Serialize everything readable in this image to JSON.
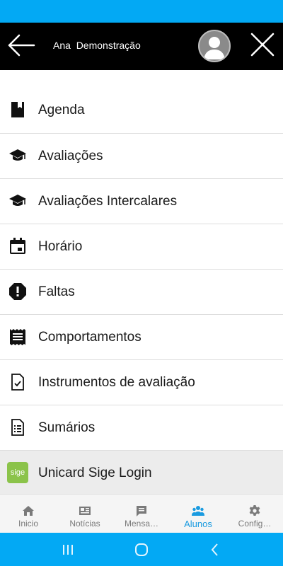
{
  "header": {
    "user_name": "Ana  Demonstração",
    "back_icon": "arrow-left-icon",
    "close_icon": "close-icon",
    "avatar_icon": "user-avatar-icon"
  },
  "menu": {
    "items": [
      {
        "label": "Agenda",
        "icon": "bookmark-icon"
      },
      {
        "label": "Avaliações",
        "icon": "graduation-cap-icon"
      },
      {
        "label": "Avaliações Intercalares",
        "icon": "graduation-cap-icon"
      },
      {
        "label": "Horário",
        "icon": "calendar-icon"
      },
      {
        "label": "Faltas",
        "icon": "alert-octagon-icon"
      },
      {
        "label": "Comportamentos",
        "icon": "receipt-icon"
      },
      {
        "label": "Instrumentos de avaliação",
        "icon": "document-check-icon"
      },
      {
        "label": "Sumários",
        "icon": "document-list-icon"
      },
      {
        "label": "Unicard Sige Login",
        "icon": "sige-logo",
        "logo_text": "sige"
      }
    ]
  },
  "bottom_nav": {
    "items": [
      {
        "label": "Inicio",
        "icon": "home-icon"
      },
      {
        "label": "Notícias",
        "icon": "newspaper-icon"
      },
      {
        "label": "Mensa…",
        "icon": "message-icon"
      },
      {
        "label": "Alunos",
        "icon": "users-icon",
        "active": true
      },
      {
        "label": "Config…",
        "icon": "gear-icon"
      }
    ]
  },
  "colors": {
    "status_bar": "#03a9f4",
    "header_bg": "#000000",
    "active_tab": "#1a9be0",
    "sige_green": "#8bc34a"
  }
}
